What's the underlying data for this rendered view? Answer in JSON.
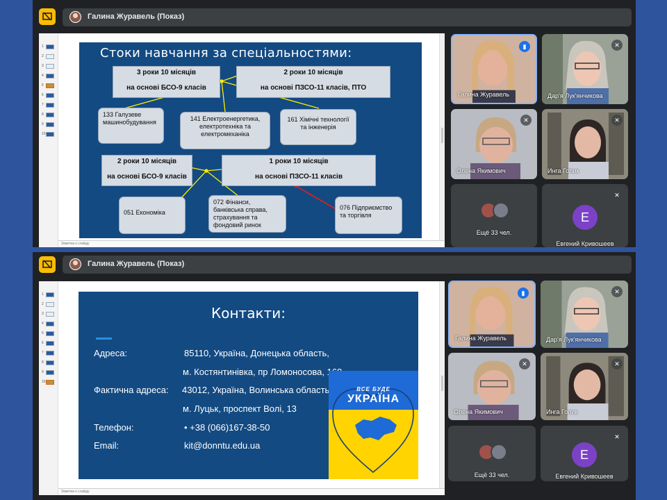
{
  "meeting": {
    "presenter": "Галина Журавель (Показ)"
  },
  "ppt": {
    "notes_label": "Заметки к слайду"
  },
  "slide1": {
    "title": "Стоки навчання за спеціальностями:",
    "box_a": {
      "line1": "3 роки 10 місяців",
      "line2": "на основі БСО-9 класів"
    },
    "box_b": {
      "line1": "2 роки 10 місяців",
      "line2": "на основі ПЗСО-11 класів,  ПТО"
    },
    "box_c": {
      "line1": "2 роки 10 місяців",
      "line2": "на основі БСО-9 класів"
    },
    "box_d": {
      "line1": "1 роки 10 місяців",
      "line2": "на основі ПЗСО-11 класів"
    },
    "spec_133": "133 Галузеве машинобудування",
    "spec_141": "141 Електроенергетика, електротехніка та електромеханіка",
    "spec_161": "161 Хімічні технології та інженерія",
    "spec_051": "051 Економіка",
    "spec_072": "072 Фінанси, банківська справа, страхування та фондовий ринок",
    "spec_076": "076 Підприємство та торгівля"
  },
  "slide2": {
    "title": "Контакти:",
    "address_label": "Адреса:",
    "address_line1": "85110, Україна, Донецька область,",
    "address_line2": "м. Костянтинівка, пр Ломоносова, 168",
    "actual_label": "Фактична адреса:",
    "actual_line1": "43012, Україна, Волинська область,",
    "actual_line2": "м. Луцьк, проспект Волі, 13",
    "phone_label": "Телефон:",
    "phone": "• +38 (066)167-38-50",
    "email_label": "Email:",
    "email": "kit@donntu.edu.ua",
    "banner_line1": "ВСЕ БУДЕ",
    "banner_line2": "УКРАЇНА"
  },
  "participants": {
    "p1": "Галина Журавель",
    "p2": "Дар'я Лук'янчикова",
    "p3": "Олена Якимович",
    "p4": "Инга Голик",
    "others": "Ещё 33 чел.",
    "p5": "Евгений Кривошеев",
    "p5_initial": "E"
  },
  "colors": {
    "slide_bg": "#134a82",
    "accent_yellow": "#fbbc04",
    "speaking_border": "#8ab4f8",
    "avatar_purple": "#7b42c7"
  }
}
